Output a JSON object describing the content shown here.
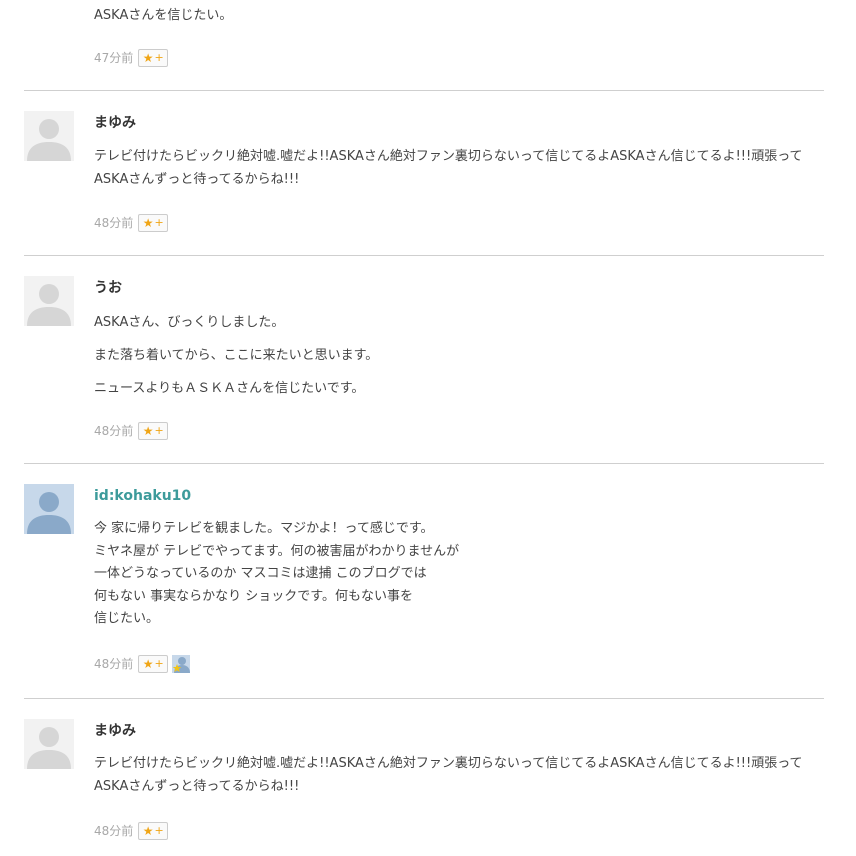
{
  "comments": [
    {
      "paragraphs": [
        "ASKAさんを信じたい。"
      ],
      "time": "47分前",
      "star_label": "★",
      "star_plus": "+"
    },
    {
      "author": "まゆみ",
      "paragraphs": [
        "テレビ付けたらビックリ絶対嘘.嘘だよ!!ASKAさん絶対ファン裏切らないって信じてるよASKAさん信じてるよ!!!頑張ってASKAさんずっと待ってるからね!!!"
      ],
      "time": "48分前",
      "star_label": "★",
      "star_plus": "+"
    },
    {
      "author": "うお",
      "paragraphs": [
        "ASKAさん、びっくりしました。",
        "また落ち着いてから、ここに来たいと思います。",
        "ニュースよりもＡＳＫＡさんを信じたいです。"
      ],
      "time": "48分前",
      "star_label": "★",
      "star_plus": "+"
    },
    {
      "author": "id:kohaku10",
      "paragraphs": [
        "今 家に帰りテレビを観ました。マジかよ！って感じです。",
        "ミヤネ屋が テレビでやってます。何の被害届がわかりませんが",
        "一体どうなっているのか マスコミは逮捕 このブログでは",
        "何もない 事実ならかなり ショックです。何もない事を",
        "信じたい。"
      ],
      "time": "48分前",
      "star_label": "★",
      "star_plus": "+"
    },
    {
      "author": "まゆみ",
      "paragraphs": [
        "テレビ付けたらビックリ絶対嘘.嘘だよ!!ASKAさん絶対ファン裏切らないって信じてるよASKAさん信じてるよ!!!頑張ってASKAさんずっと待ってるからね!!!"
      ],
      "time": "48分前",
      "star_label": "★",
      "star_plus": "+"
    }
  ],
  "colors": {
    "link_name": "#3d9b9b",
    "star": "#f0a515",
    "divider": "#cfcfcf",
    "avatar_gray": "#dcdcdc",
    "avatar_blue": "#9db7d3"
  }
}
